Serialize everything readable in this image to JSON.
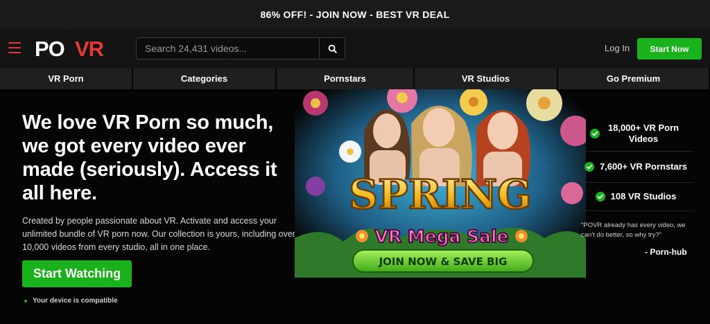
{
  "promo_bar": {
    "text": "86% OFF! - JOIN NOW - BEST VR DEAL"
  },
  "header": {
    "logo_text": "POVR",
    "search": {
      "placeholder": "Search 24,431 videos...",
      "value": ""
    },
    "login_label": "Log In",
    "start_label": "Start Now"
  },
  "nav": {
    "items": [
      "VR Porn",
      "Categories",
      "Pornstars",
      "VR Studios",
      "Go Premium"
    ]
  },
  "hero": {
    "headline": "We love VR Porn so much, we got every video ever made (seriously). Access it all here.",
    "description": "Created by people passionate about VR. Activate and access your unlimited bundle of VR porn now. Our collection is yours, including over 10,000 videos from every studio, all in one place.",
    "cta_label": "Start Watching",
    "compat_text": "Your device is compatible"
  },
  "banner": {
    "title": "SPRING",
    "subtitle": "VR Mega Sale",
    "button_label": "JOIN NOW & SAVE BIG"
  },
  "stats": [
    {
      "label": "18,000+ VR Porn Videos"
    },
    {
      "label": "7,600+ VR Pornstars"
    },
    {
      "label": "108 VR Studios"
    }
  ],
  "quote": {
    "text": "\"POVR already has every video, we can't do better, so why try?\"",
    "author": "- Porn-hub"
  },
  "colors": {
    "accent_green": "#19b21d",
    "logo_red": "#e53935",
    "bg": "#050505"
  }
}
